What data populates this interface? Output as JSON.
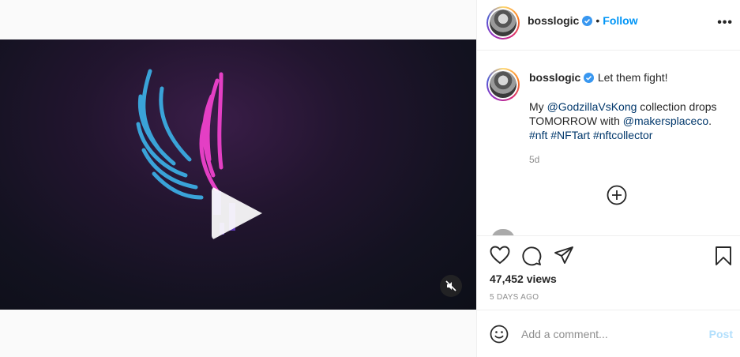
{
  "header": {
    "username": "bosslogic",
    "separator": "•",
    "follow_label": "Follow",
    "more_label": "•••"
  },
  "caption": {
    "username": "bosslogic",
    "headline": "Let them fight!",
    "line_prefix": "My ",
    "mention_1": "@GodzillaVsKong",
    "line_mid": " collection drops TOMORROW with ",
    "mention_2": "@makersplaceco",
    "line_end": ".",
    "hashtag_1": "#nft",
    "hashtag_2": "#NFTart",
    "hashtag_3": "#nftcollector",
    "time": "5d"
  },
  "stats": {
    "views": "47,452 views",
    "posted": "5 DAYS AGO"
  },
  "comment": {
    "placeholder": "Add a comment...",
    "post_label": "Post"
  },
  "colors": {
    "accent": "#0095f6",
    "post_disabled": "#b2dffc",
    "wing_blue": "#3aa3d8",
    "wing_pink": "#e43fc4",
    "verified": "#3897f0"
  },
  "icons": [
    "play-icon",
    "muted-speaker-icon",
    "verified-badge-icon",
    "more-options-icon",
    "add-circle-icon",
    "heart-icon",
    "comment-icon",
    "share-icon",
    "bookmark-icon",
    "emoji-icon"
  ]
}
